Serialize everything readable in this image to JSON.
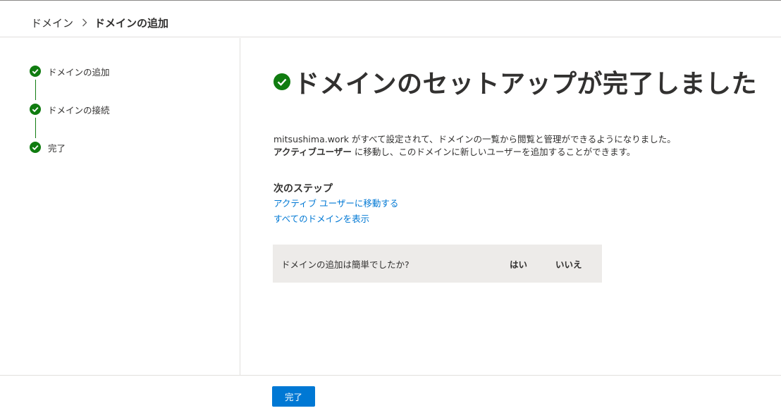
{
  "breadcrumb": {
    "parent": "ドメイン",
    "current": "ドメインの追加"
  },
  "steps": [
    {
      "label": "ドメインの追加",
      "status": "complete"
    },
    {
      "label": "ドメインの接続",
      "status": "complete"
    },
    {
      "label": "完了",
      "status": "complete"
    }
  ],
  "main": {
    "title": "ドメインのセットアップが完了しました",
    "desc_line1": "mitsushima.work がすべて設定されて、ドメインの一覧から閲覧と管理ができるようになりました。",
    "desc_line2_bold": "アクティブユーザー",
    "desc_line2_rest": " に移動し、このドメインに新しいユーザーを追加することができます。",
    "next_steps_heading": "次のステップ",
    "link_users": "アクティブ ユーザーに移動する",
    "link_domains": "すべてのドメインを表示"
  },
  "feedback": {
    "question": "ドメインの追加は簡単でしたか?",
    "yes": "はい",
    "no": "いいえ"
  },
  "footer": {
    "done_label": "完了"
  },
  "colors": {
    "accent": "#0078d4",
    "success": "#107c10",
    "feedback_bg": "#edebe9"
  },
  "icons": {
    "step_status": "check-circle-icon",
    "breadcrumb_separator": "chevron-right-icon"
  }
}
